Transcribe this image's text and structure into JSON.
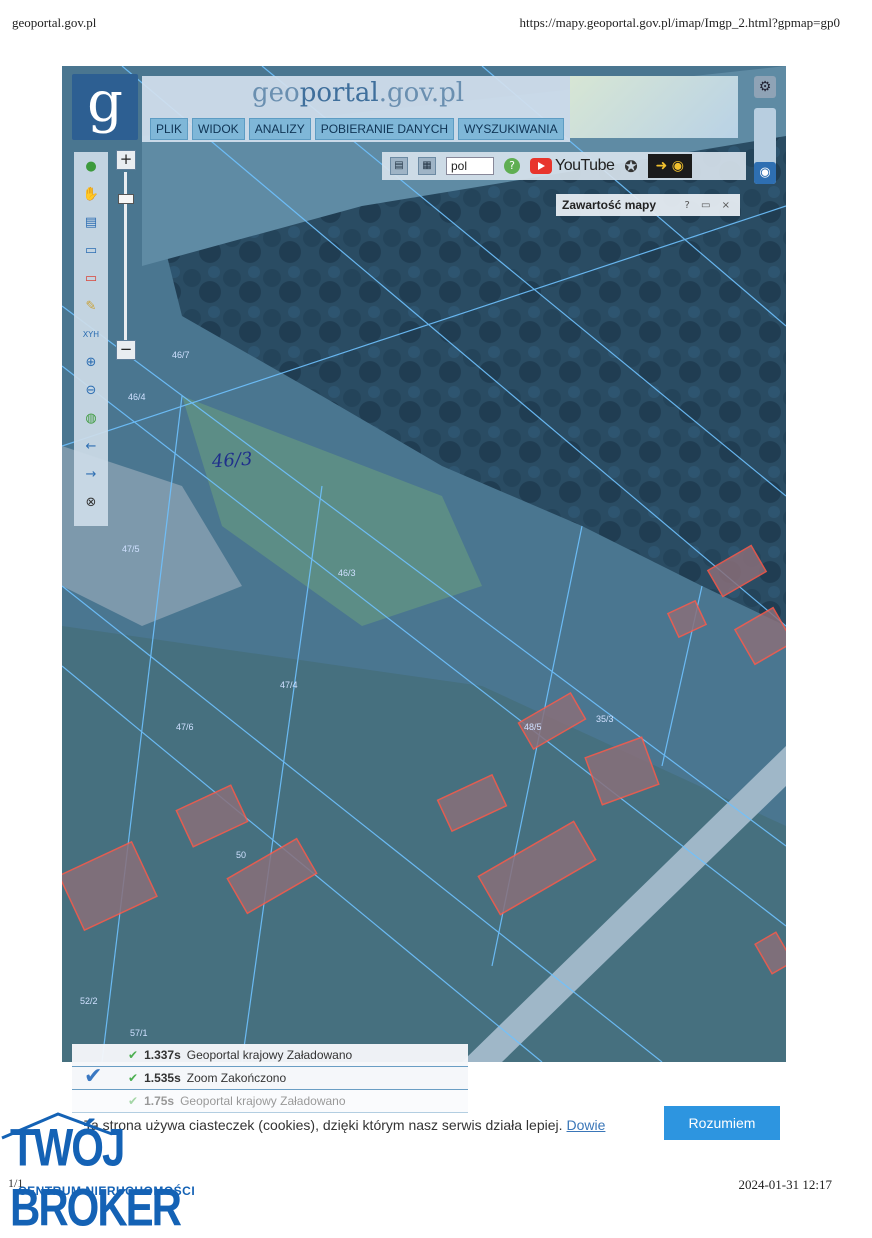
{
  "print_header": {
    "site": "geoportal.gov.pl",
    "url": "https://mapy.geoportal.gov.pl/imap/Imgp_2.html?gpmap=gp0"
  },
  "app": {
    "logo_letter": "g",
    "brand_prefix": "geo",
    "brand_main": "portal",
    "brand_suffix": ".gov.pl",
    "menu": [
      "PLIK",
      "WIDOK",
      "ANALIZY",
      "POBIERANIE DANYCH",
      "WYSZUKIWANIA"
    ]
  },
  "toolbar": {
    "language_value": "pol",
    "youtube_label": "YouTube",
    "icons": [
      "legend-icon",
      "wms-icon",
      "help-icon",
      "youtube-icon",
      "settings-wheel-icon",
      "eye-toggle-icon"
    ]
  },
  "panel": {
    "title": "Zawartość mapy",
    "controls": "? ▭ ×"
  },
  "map": {
    "handwritten_note": "46/3",
    "parcel_labels": [
      "46/7",
      "46/4",
      "47/5",
      "46/3",
      "47/4",
      "47/6",
      "48/5",
      "35/3",
      "50",
      "52/2",
      "57/1"
    ]
  },
  "status_log": [
    {
      "time": "1.337s",
      "text": "Geoportal krajowy  Załadowano"
    },
    {
      "time": "1.535s",
      "text": "Zoom  Zakończono"
    },
    {
      "time": "1.75s",
      "text": "Geoportal krajowy  Załadowano"
    }
  ],
  "cookie_bar": {
    "text": "Ta strona używa ciasteczek (cookies), dzięki którym nasz serwis działa lepiej.",
    "link": "Dowie",
    "button": "Rozumiem"
  },
  "stamp": {
    "title": "TWÓJ BROKER",
    "subtitle": "CENTRUM NIERUCHOMOŚCI"
  },
  "footer": {
    "page_number": "1/1",
    "date": "2024-01-31 12:17"
  },
  "colors": {
    "map_tint": "#3e6b8a",
    "accent_blue": "#2d95e0",
    "stamp_blue": "#1462b5",
    "building_red": "#e0453d"
  }
}
